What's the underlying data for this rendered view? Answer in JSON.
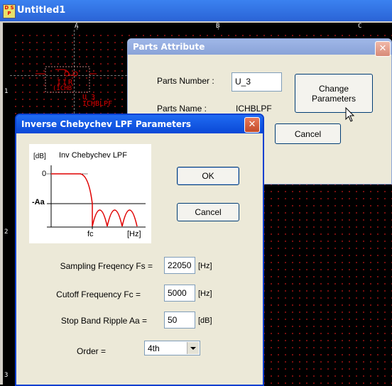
{
  "main_window": {
    "icon_text": "D S P",
    "title": "Untitled1",
    "ruler_columns": [
      "A",
      "B",
      "C"
    ],
    "ruler_rows": [
      "1",
      "2",
      "3"
    ]
  },
  "schematic_part": {
    "block_label_top": "IIR",
    "block_label_bottom": "(ICHB",
    "ref_name": "U_3",
    "type_name": "ICHBLPF"
  },
  "parts_attribute": {
    "title": "Parts Attribute",
    "parts_number_label": "Parts Number :",
    "parts_number_value": "U_3",
    "parts_name_label": "Parts Name :",
    "parts_name_value": "ICHBLPF",
    "change_button": "Change\nParameters",
    "cancel_button": "Cancel",
    "close_symbol": "✕"
  },
  "lpf_dialog": {
    "title": "Inverse Chebychev LPF Parameters",
    "close_symbol": "✕",
    "diagram": {
      "unit_db": "[dB]",
      "caption": "Inv Chebychev LPF",
      "zero_label": "0",
      "aa_label": "-Aa",
      "fc_label": "fc",
      "unit_hz": "[Hz]",
      "curve_color": "#e00000"
    },
    "ok_button": "OK",
    "cancel_button": "Cancel",
    "fields": [
      {
        "label": "Sampling Freqency Fs =",
        "value": "22050",
        "unit": "[Hz]"
      },
      {
        "label": "Cutoff Frequency Fc =",
        "value": "5000",
        "unit": "[Hz]"
      },
      {
        "label": "Stop Band Ripple Aa =",
        "value": "50",
        "unit": "[dB]"
      }
    ],
    "order_label": "Order =",
    "order_selected": "4th"
  }
}
